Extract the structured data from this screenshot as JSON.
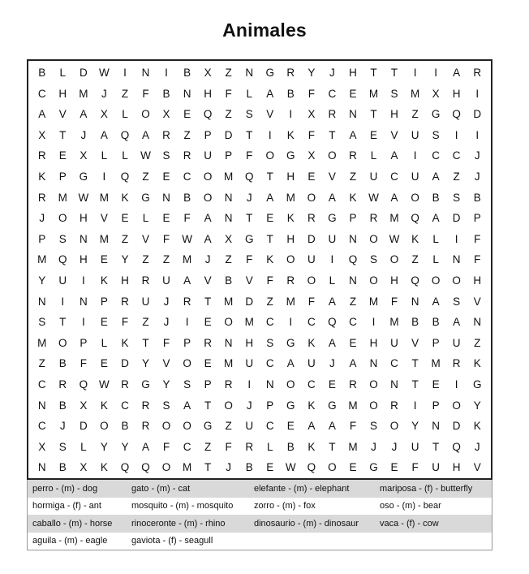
{
  "title": "Animales",
  "grid": [
    "BLDWINIBXZNGRYJHTTIIAR",
    "CHMJZFBNHFLABFCEMSMXHI",
    "AVAXLOXEQZSVIXRNTHZGQD",
    "XTJAQARZPDTIKFTAEVUSII",
    "REXLLWSRUPFOGXORLAICCJ",
    "KPGIQZECOMQTHEVZUCUAZJ",
    "RMWMKGNBONJAMOAKWAOBSB",
    "JOHVELEFANTEKRGPRMQADP",
    "PSNMZVFWAXGTHDUNOWKLIF",
    "MQHEYZZMJZFKOUIQSOZLNF",
    "YUIKHRUAVBVFROLNOHQOOH",
    "NINPRUJRTMDZMFAZMFNASV",
    "STIEFZJIEOMCICQCIMBBAN",
    "MOPLKTFPRNHSGKAEHUVPUZ",
    "ZBFEDYVOEMUCAUJANCTMRK",
    "CRQWRGYSPRINOCERONTEIG",
    "NBXKCRSATOJPGKGMORIPOY",
    "CJDOBROOGZUCEAAFSOYNDK",
    "XSLYYAFCZFRLBKTMJJUTQJ",
    "NBXKQQOMTJBEWQOEGEFUHV"
  ],
  "clues": [
    [
      "perro - (m) - dog",
      "gato - (m) - cat",
      "elefante - (m) - elephant",
      "mariposa - (f) - butterfly"
    ],
    [
      "hormiga - (f) - ant",
      "mosquito - (m) - mosquito",
      "zorro - (m) - fox",
      "oso - (m) - bear"
    ],
    [
      "caballo - (m) - horse",
      "rinoceronte - (m) - rhino",
      "dinosaurio - (m) - dinosaur",
      "vaca - (f) - cow"
    ],
    [
      "aguila - (m) - eagle",
      "gaviota - (f) - seagull",
      "",
      ""
    ]
  ]
}
